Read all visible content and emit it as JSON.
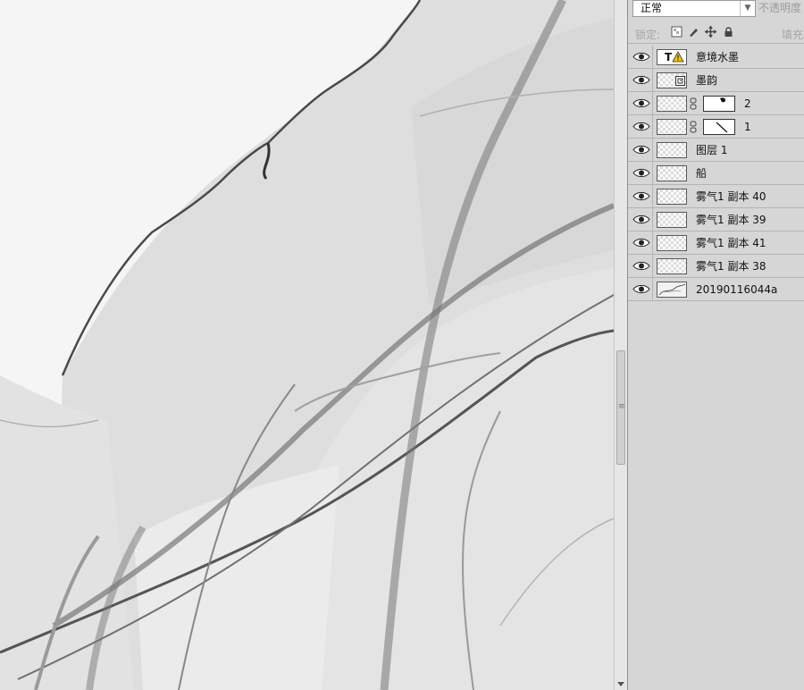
{
  "layers_panel": {
    "blend_mode": "正常",
    "opacity_label": "不透明度",
    "lock_label": "锁定:",
    "fill_label": "填充",
    "lock_icons": [
      "lock-transparent-icon",
      "brush-icon",
      "move-icon",
      "lock-all-icon"
    ],
    "layers": [
      {
        "name": "意境水墨",
        "type": "text-warning"
      },
      {
        "name": "墨韵",
        "type": "smart-object"
      },
      {
        "name": "2",
        "type": "masked"
      },
      {
        "name": "1",
        "type": "masked"
      },
      {
        "name": "图层 1",
        "type": "normal"
      },
      {
        "name": "船",
        "type": "normal"
      },
      {
        "name": "雾气1 副本 40",
        "type": "normal"
      },
      {
        "name": "雾气1 副本 39",
        "type": "normal"
      },
      {
        "name": "雾气1 副本 41",
        "type": "normal"
      },
      {
        "name": "雾气1 副本 38",
        "type": "normal"
      },
      {
        "name": "20190116044a",
        "type": "image"
      }
    ]
  },
  "colors": {
    "panel_bg": "#d6d6d6",
    "canvas_bg": "#f4f4f4",
    "ink_dark": "#3a3a3a",
    "warning_yellow": "#f2c200"
  }
}
